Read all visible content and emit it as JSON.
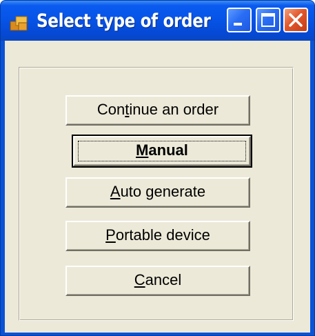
{
  "window": {
    "title": "Select type of order"
  },
  "titlebar_buttons": {
    "minimize_icon": "minimize-icon",
    "maximize_icon": "maximize-icon",
    "close_icon": "close-icon"
  },
  "buttons": {
    "continue": {
      "pre": "Con",
      "key": "t",
      "post": "inue an order"
    },
    "manual": {
      "pre": "",
      "key": "M",
      "post": "anual"
    },
    "auto": {
      "pre": "",
      "key": "A",
      "post": "uto generate"
    },
    "portable": {
      "pre": "",
      "key": "P",
      "post": "ortable device"
    },
    "cancel": {
      "pre": "",
      "key": "C",
      "post": "ancel"
    }
  },
  "colors": {
    "titlebar": "#0653e6",
    "client": "#ece9d8",
    "close_button": "#e2572c"
  }
}
